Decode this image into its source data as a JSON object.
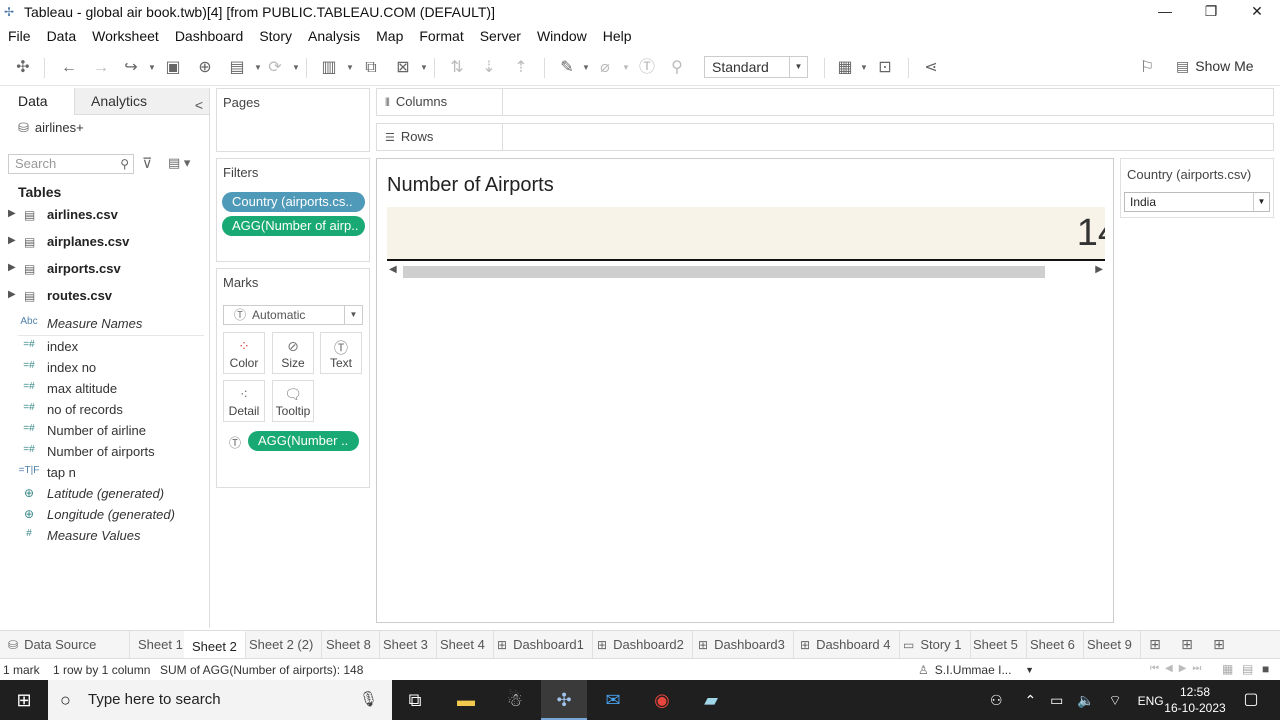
{
  "window": {
    "title": "Tableau - global air book.twb)[4] [from PUBLIC.TABLEAU.COM (DEFAULT)]",
    "minimize": "—",
    "restore": "❐",
    "close": "✕"
  },
  "menu": [
    "File",
    "Data",
    "Worksheet",
    "Dashboard",
    "Story",
    "Analysis",
    "Map",
    "Format",
    "Server",
    "Window",
    "Help"
  ],
  "toolbar": {
    "fit_value": "Standard",
    "show_me_label": "Show Me"
  },
  "data_pane": {
    "tab_data": "Data",
    "tab_analytics": "Analytics",
    "collapse": "<",
    "datasource": "airlines+",
    "search_placeholder": "Search",
    "tables_header": "Tables",
    "tables": [
      {
        "name": "airlines.csv"
      },
      {
        "name": "airplanes.csv"
      },
      {
        "name": "airports.csv"
      },
      {
        "name": "routes.csv"
      }
    ],
    "fields": [
      {
        "type": "Abc",
        "name": "Measure Names",
        "italic": true
      },
      {
        "type": "=#",
        "name": "index",
        "italic": false
      },
      {
        "type": "=#",
        "name": "index no",
        "italic": false
      },
      {
        "type": "=#",
        "name": "max altitude",
        "italic": false
      },
      {
        "type": "=#",
        "name": "no of records",
        "italic": false
      },
      {
        "type": "=#",
        "name": "Number of airline",
        "italic": false
      },
      {
        "type": "=#",
        "name": "Number of airports",
        "italic": false
      },
      {
        "type": "=T|F",
        "name": "tap n",
        "italic": false
      },
      {
        "type": "globe",
        "name": "Latitude (generated)",
        "italic": true
      },
      {
        "type": "globe",
        "name": "Longitude (generated)",
        "italic": true
      },
      {
        "type": "#",
        "name": "Measure Values",
        "italic": true
      }
    ]
  },
  "pages": {
    "label": "Pages"
  },
  "filters": {
    "label": "Filters",
    "pills": [
      "Country (airports.cs..",
      "AGG(Number of airp.."
    ]
  },
  "marks": {
    "label": "Marks",
    "type": "Automatic",
    "buttons": [
      "Color",
      "Size",
      "Text",
      "Detail",
      "Tooltip"
    ],
    "pill": "AGG(Number .."
  },
  "shelves": {
    "columns": "Columns",
    "rows": "Rows"
  },
  "viz": {
    "title": "Number of Airports",
    "value_shown": "14"
  },
  "quick_filter": {
    "title": "Country (airports.csv)",
    "value": "India"
  },
  "sheet_tabs": [
    {
      "label": "Data Source",
      "icon": "datasource"
    },
    {
      "label": "Sheet 1",
      "icon": ""
    },
    {
      "label": "Sheet 2",
      "icon": "",
      "active": true
    },
    {
      "label": "Sheet 2 (2)",
      "icon": ""
    },
    {
      "label": "Sheet 8",
      "icon": ""
    },
    {
      "label": "Sheet 3",
      "icon": ""
    },
    {
      "label": "Sheet 4",
      "icon": ""
    },
    {
      "label": "Dashboard1",
      "icon": "dashboard"
    },
    {
      "label": "Dashboard2",
      "icon": "dashboard"
    },
    {
      "label": "Dashboard3",
      "icon": "dashboard"
    },
    {
      "label": "Dashboard 4",
      "icon": "dashboard"
    },
    {
      "label": "Story 1",
      "icon": "story"
    },
    {
      "label": "Sheet 5",
      "icon": ""
    },
    {
      "label": "Sheet 6",
      "icon": ""
    },
    {
      "label": "Sheet 9",
      "icon": ""
    }
  ],
  "status": {
    "marks": "1 mark",
    "rows": "1 row by 1 column",
    "sum": "SUM of AGG(Number of airports): 148",
    "user": "S.I.Ummae I..."
  },
  "taskbar": {
    "search_placeholder": "Type here to search",
    "lang": "ENG",
    "time": "12:58",
    "date": "16-10-2023"
  }
}
